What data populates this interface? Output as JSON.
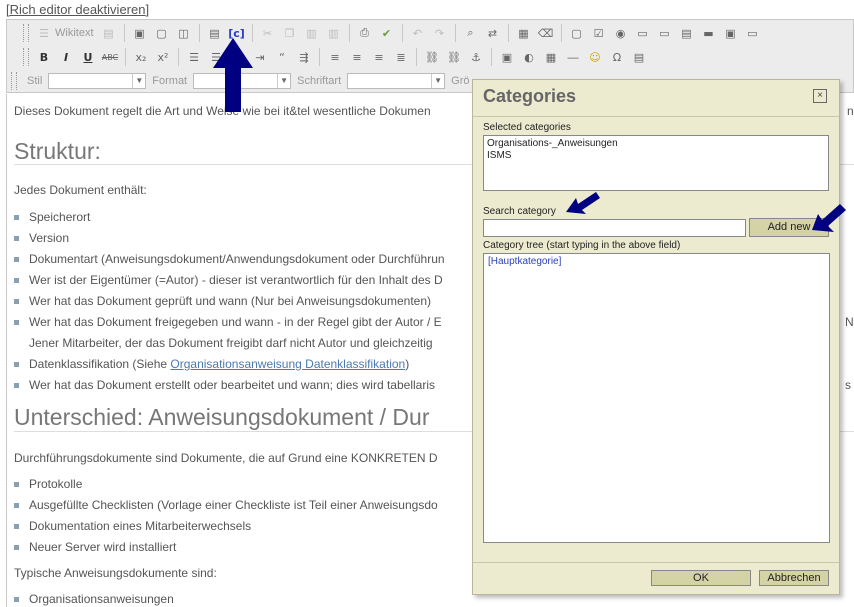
{
  "editor": {
    "deactivate_link": "[Rich editor deaktivieren]",
    "wikitext_label": "Wikitext",
    "style_label": "Stil",
    "format_label": "Format",
    "font_label": "Schriftart",
    "size_label": "Grö",
    "accent_color": "#000080"
  },
  "document": {
    "intro": "Dieses Dokument regelt die Art und Weise wie bei it&tel wesentliche Dokumen",
    "intro_tail": "n",
    "heading1": "Struktur:",
    "p1": "Jedes Dokument enthält:",
    "items1": [
      "Speicherort",
      "Version",
      "Dokumentart (Anweisungsdokument/Anwendungsdokument oder Durchführun",
      "Wer ist der Eigentümer (=Autor) - dieser ist verantwortlich für den Inhalt des D",
      "Wer hat das Dokument geprüft und wann (Nur bei Anweisungsdokumenten)",
      "Wer hat das Dokument freigegeben und wann - in der Regel gibt der Autor / E"
    ],
    "item1_cont": "Jener Mitarbeiter, der das Dokument freigibt darf nicht Autor und gleichzeitig",
    "items1_tail": "N",
    "classification_prefix": "Datenklassifikation (Siehe ",
    "classification_link": "Organisationsanweisung Datenklassifikation",
    "classification_suffix": ")",
    "item_last": "Wer hat das Dokument erstellt oder bearbeitet und wann; dies wird tabellaris",
    "item_last_tail": "s",
    "heading2": "Unterschied: Anweisungsdokument / Dur",
    "p2": "Durchführungsdokumente sind Dokumente, die auf Grund eine KONKRETEN D",
    "items2": [
      "Protokolle",
      "Ausgefüllte Checklisten (Vorlage einer Checkliste ist Teil einer Anweisungsdo",
      "Dokumentation eines Mitarbeiterwechsels",
      "Neuer Server wird installiert"
    ],
    "p3": "Typische Anweisungsdokumente sind:",
    "items3": [
      "Organisationsanweisungen"
    ]
  },
  "dialog": {
    "title": "Categories",
    "close": "×",
    "selected_label": "Selected categories",
    "selected": [
      "Organisations-_Anweisungen",
      "ISMS"
    ],
    "search_label": "Search category",
    "search_value": "",
    "add_new": "Add new",
    "tree_label": "Category tree (start typing in the above field)",
    "tree_root": "[Hauptkategorie]",
    "ok": "OK",
    "cancel": "Abbrechen"
  }
}
